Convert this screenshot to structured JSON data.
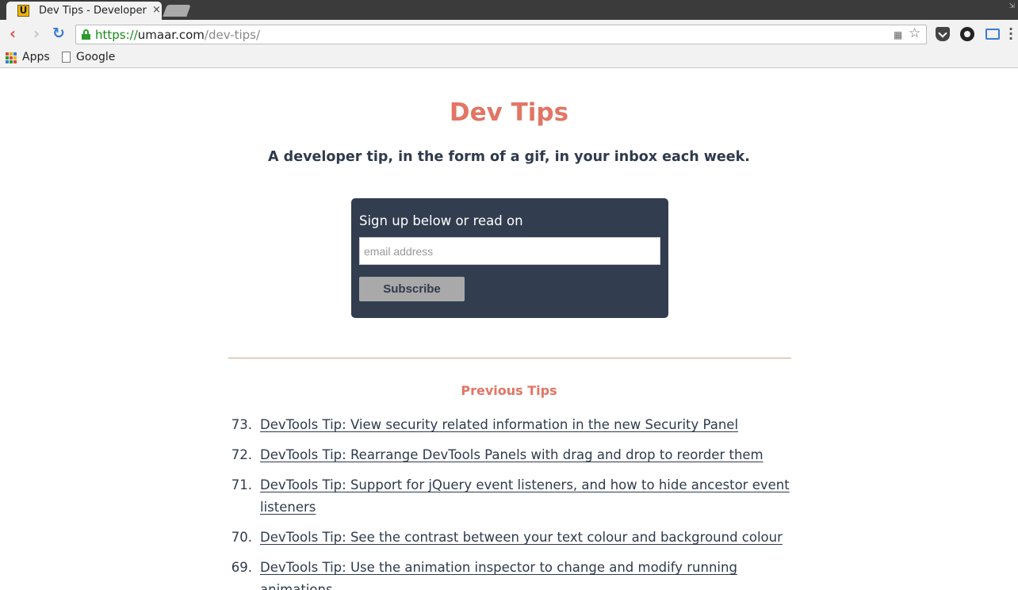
{
  "browser": {
    "tab_title": "Dev Tips - Developer",
    "tab_favicon_letter": "U",
    "tab_close": "×",
    "url_scheme": "https://",
    "url_host": "umaar.com",
    "url_path": "/dev-tips/",
    "bookmarks": [
      {
        "label": "Apps"
      },
      {
        "label": "Google"
      }
    ]
  },
  "page": {
    "title": "Dev Tips",
    "tagline": "A developer tip, in the form of a gif, in your inbox each week.",
    "signup": {
      "label": "Sign up below or read on",
      "email_placeholder": "email address",
      "subscribe_label": "Subscribe"
    },
    "previous_heading": "Previous Tips",
    "tips": [
      {
        "num": "73.",
        "text": "DevTools Tip: View security related information in the new Security Panel"
      },
      {
        "num": "72.",
        "text": "DevTools Tip: Rearrange DevTools Panels with drag and drop to reorder them"
      },
      {
        "num": "71.",
        "text": "DevTools Tip: Support for jQuery event listeners, and how to hide ancestor event listeners"
      },
      {
        "num": "70.",
        "text": "DevTools Tip: See the contrast between your text colour and background colour"
      },
      {
        "num": "69.",
        "text": "DevTools Tip: Use the animation inspector to change and modify running animations"
      }
    ]
  },
  "colors": {
    "accent": "#e27564",
    "navy": "#323d50",
    "text": "#2f3a4c"
  }
}
